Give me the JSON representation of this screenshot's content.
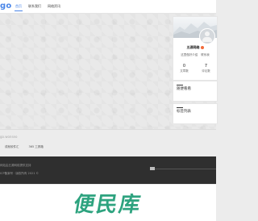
{
  "header": {
    "logo": "go",
    "nav": [
      {
        "label": "首页"
      },
      {
        "label": "联系我们"
      },
      {
        "label": "网络资讯"
      }
    ]
  },
  "profile": {
    "username": "五源网络",
    "links": [
      "这里做好介绍",
      "联系我"
    ],
    "stats": [
      {
        "value": "0",
        "label": "文章数"
      },
      {
        "value": "7",
        "label": "评论数"
      }
    ]
  },
  "widgets": [
    {
      "title": "随便看看"
    },
    {
      "title": "标签列表"
    }
  ],
  "footer": {
    "tagline": "go.wonseo",
    "friend_links": [
      "成就软件汇",
      "365 工具箱"
    ],
    "line1": "网站由五源网络提供支持",
    "line2": "ICP备案号 · 版权所有 2021 ©"
  },
  "watermark": "便民库",
  "colors": {
    "accent": "#4a86e8",
    "dark_footer": "#2f2f2f",
    "watermark": "#2ea37f",
    "badge": "#f26b3a"
  }
}
